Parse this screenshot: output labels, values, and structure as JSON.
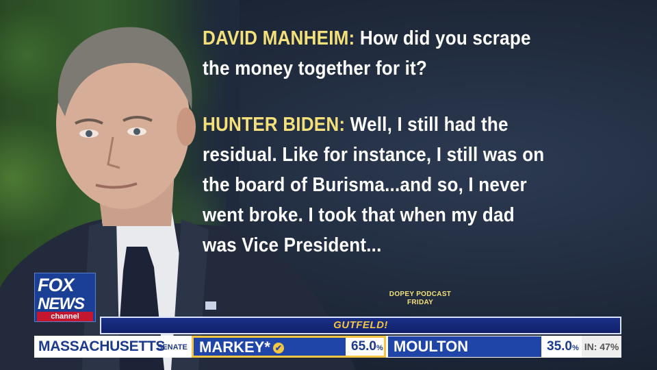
{
  "transcript": {
    "q_speaker": "DAVID MANHEIM:",
    "q_line1": "How did you scrape",
    "q_line2": "the money together for it?",
    "a_speaker": "HUNTER BIDEN:",
    "a_line1": "Well, I still had the",
    "a_line2": "residual. Like for instance, I still was on",
    "a_line3": "the board of Burisma...and so, I never",
    "a_line4": "went broke. I took that when my dad",
    "a_line5": "was Vice President..."
  },
  "promo": {
    "line1": "DOPEY PODCAST",
    "line2": "FRIDAY"
  },
  "logo": {
    "fox": "FOX",
    "news": "NEWS",
    "channel": "channel"
  },
  "show": {
    "name": "GUTFELD!"
  },
  "ticker": {
    "state": "MASSACHUSETTS",
    "race": "SENATE",
    "candidates": [
      {
        "name": "MARKEY*",
        "pct": "65.0",
        "pct_sign": "%",
        "winner": true
      },
      {
        "name": "MOULTON",
        "pct": "35.0",
        "pct_sign": "%",
        "winner": false
      }
    ],
    "reporting": "IN: 47%"
  },
  "colors": {
    "speaker_yellow": "#f4e07a",
    "fox_blue": "#1b3f94",
    "fox_red": "#c5162f",
    "winner_gold": "#f4c542"
  }
}
